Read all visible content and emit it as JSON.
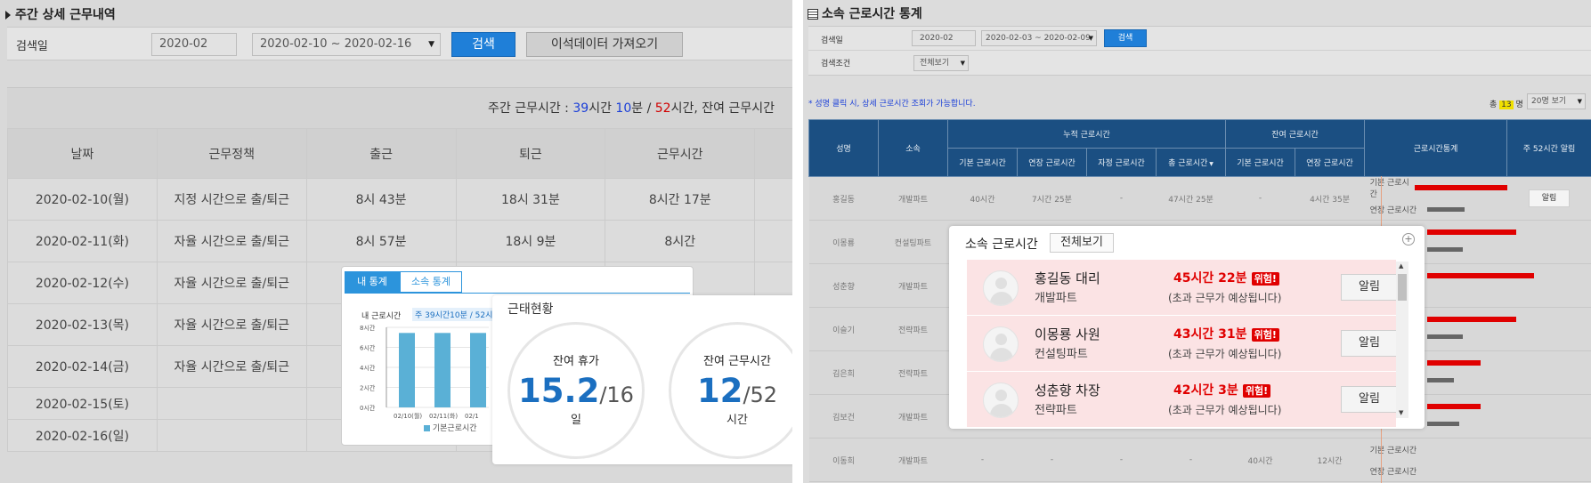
{
  "left": {
    "title": "주간 상세 근무내역",
    "search": {
      "label": "검색일",
      "month": "2020-02",
      "range": "2020-02-10 ~ 2020-02-16",
      "search_btn": "검색",
      "import_btn": "이석데이터 가져오기"
    },
    "summary": {
      "prefix": "주간 근무시간 : ",
      "h": "39",
      "h_unit": "시간 ",
      "m": "10",
      "m_unit": "분 / ",
      "max": "52",
      "tail": "시간, 잔여 근무시간"
    },
    "headers": [
      "날짜",
      "근무정책",
      "출근",
      "퇴근",
      "근무시간"
    ],
    "rows": [
      [
        "2020-02-10(월)",
        "지정 시간으로 출/퇴근",
        "8시 43분",
        "18시 31분",
        "8시간 17분"
      ],
      [
        "2020-02-11(화)",
        "자율 시간으로 출/퇴근",
        "8시 57분",
        "18시 9분",
        "8시간"
      ],
      [
        "2020-02-12(수)",
        "자율 시간으로 출/퇴근",
        "",
        "",
        ""
      ],
      [
        "2020-02-13(목)",
        "자율 시간으로 출/퇴근",
        "",
        "",
        ""
      ],
      [
        "2020-02-14(금)",
        "자율 시간으로 출/퇴근",
        "",
        "",
        ""
      ],
      [
        "2020-02-15(토)",
        "",
        "",
        "",
        ""
      ],
      [
        "2020-02-16(일)",
        "",
        "",
        "",
        ""
      ]
    ],
    "stats_tabs": [
      "내 통계",
      "소속 통계"
    ],
    "mini_chart": {
      "label": "내 근로시간",
      "badge": "주 39시간10분 / 52시",
      "yticks": [
        "8시간",
        "6시간",
        "4시간",
        "2시간",
        "0시간"
      ],
      "xticks": [
        "02/10(월)",
        "02/11(화)",
        "02/1"
      ],
      "legend": "기본근로시간"
    },
    "status": {
      "title": "근태현황",
      "leave_label": "잔여 휴가",
      "leave_value": "15.2",
      "leave_total": "/16",
      "leave_unit": "일",
      "work_label": "잔여 근무시간",
      "work_value": "12",
      "work_total": "/52",
      "work_unit": "시간"
    }
  },
  "right": {
    "title": "소속 근로시간 통계",
    "search": {
      "date_label": "검색일",
      "month": "2020-02",
      "range": "2020-02-03 ~ 2020-02-09",
      "search_btn": "검색",
      "cond_label": "검색조건",
      "cond_value": "전체보기"
    },
    "notice": "* 성명 클릭 시, 상세 근로시간 조회가 가능합니다.",
    "total_prefix": "총",
    "total_count": "13",
    "total_suffix": "명",
    "page_size": "20명 보기",
    "headers": {
      "name": "성명",
      "dept": "소속",
      "acc": "누적 근로시간",
      "remain": "잔여 근로시간",
      "stats": "근로시간통계",
      "alert52": "주 52시간 알림",
      "basic": "기본 근로시간",
      "ext": "연장 근로시간",
      "self": "자정 근로시간",
      "total": "총 근로시간"
    },
    "rows": [
      {
        "name": "홍길동",
        "dept": "개발파트",
        "basic": "40시간",
        "ext": "7시간 25분",
        "self": "-",
        "total": "47시간 25분",
        "rbasic": "-",
        "rext": "4시간 35분"
      },
      {
        "name": "이몽룡",
        "dept": "컨설팅파트"
      },
      {
        "name": "성춘향",
        "dept": "개발파트"
      },
      {
        "name": "이슬기",
        "dept": "전략파트"
      },
      {
        "name": "김은희",
        "dept": "전략파트"
      },
      {
        "name": "김보건",
        "dept": "개발파트"
      },
      {
        "name": "이동희",
        "dept": "개발파트",
        "basic": "-",
        "ext": "-",
        "self": "-",
        "total": "-",
        "rbasic": "40시간",
        "rext": "12시간"
      }
    ],
    "legend_basic": "기본 근로시간",
    "legend_ext": "연장 근로시간",
    "alert_btn": "알림",
    "popup": {
      "title": "소속 근로시간",
      "view_all": "전체보기",
      "people": [
        {
          "name": "홍길동 대리",
          "dept": "개발파트",
          "time": "45시간 22분",
          "tag": "위험!",
          "note": "(초과 근무가 예상됩니다)",
          "btn": "알림"
        },
        {
          "name": "이몽룡 사원",
          "dept": "컨설팅파트",
          "time": "43시간 31분",
          "tag": "위험!",
          "note": "(초과 근무가 예상됩니다)",
          "btn": "알림"
        },
        {
          "name": "성춘향 차장",
          "dept": "전략파트",
          "time": "42시간 3분",
          "tag": "위험!",
          "note": "(초과 근무가 예상됩니다)",
          "btn": "알림"
        }
      ]
    }
  },
  "colors": {
    "accent": "#1f7fd8",
    "navy": "#1b4f82",
    "danger": "#e00000",
    "pink": "#fbe3e4",
    "big_number": "#1b6fc0"
  }
}
